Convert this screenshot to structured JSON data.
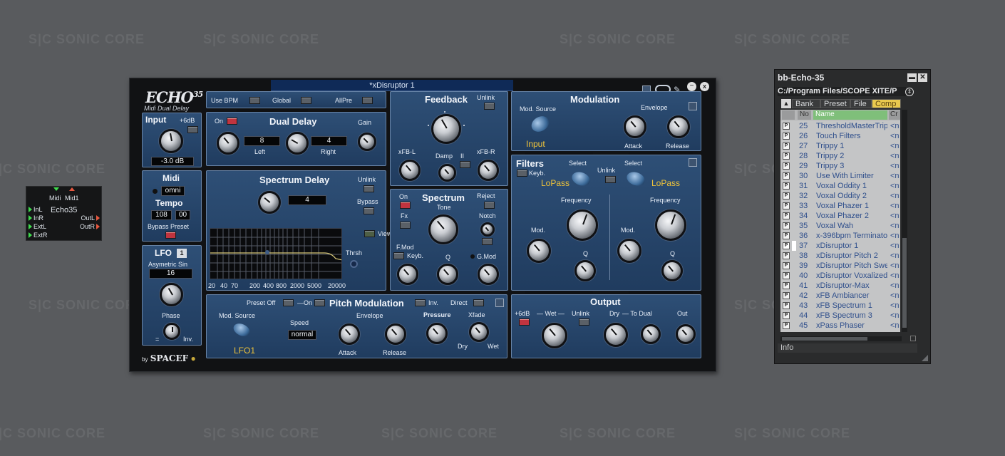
{
  "watermark": "S|C SONIC CORE",
  "module": {
    "top_ports": [
      "Midi",
      "Mid1"
    ],
    "name": "Echo35",
    "inputs": [
      "InL",
      "InR",
      "ExtL",
      "ExtR"
    ],
    "outputs": [
      "OutL",
      "OutR"
    ]
  },
  "plugin": {
    "title": "*xDisruptor 1",
    "logo_main": "ECHO",
    "logo_num": "35",
    "subtitle": "Midi Dual Delay",
    "by": "by",
    "brand": "SPACEF",
    "input": {
      "label": "Input",
      "plus6": "+6dB",
      "value": "-3.0 dB"
    },
    "midi": {
      "label": "Midi",
      "channel": "omni",
      "tempo_label": "Tempo",
      "tempo_int": "108",
      "tempo_frac": "00",
      "bypass_preset": "Bypass Preset"
    },
    "lfo": {
      "label": "LFO",
      "num": "1",
      "shape": "Asymetric Sin",
      "value": "16",
      "phase": "Phase",
      "eq": "=",
      "inv": "Inv."
    },
    "sync_bar": {
      "use_bpm": "Use BPM",
      "global": "Global",
      "allpre": "AllPre"
    },
    "dual_delay": {
      "label": "Dual Delay",
      "on": "On",
      "gain": "Gain",
      "left_value": "8",
      "right_value": "4",
      "left": "Left",
      "right": "Right"
    },
    "spectrum_delay": {
      "label": "Spectrum Delay",
      "value": "4",
      "unlink": "Unlink",
      "bypass": "Bypass",
      "view": "View",
      "thrsh": "Thrsh",
      "freq_ticks": [
        "20",
        "40",
        "70",
        "200",
        "400",
        "800",
        "2000",
        "5000",
        "20000"
      ]
    },
    "feedback": {
      "label": "Feedback",
      "unlink": "Unlink",
      "xfb_l": "xFB-L",
      "xfb_r": "xFB-R",
      "damp": "Damp",
      "damp_mark": "II"
    },
    "spectrum": {
      "label": "Spectrum",
      "on": "On",
      "fx": "Fx",
      "tone": "Tone",
      "reject": "Reject",
      "notch": "Notch",
      "fmod": "F.Mod",
      "keyb": "Keyb.",
      "q": "Q",
      "gmod": "G.Mod"
    },
    "modulation": {
      "label": "Modulation",
      "mod_source": "Mod. Source",
      "source_value": "Input",
      "envelope": "Envelope",
      "attack": "Attack",
      "release": "Release"
    },
    "filters": {
      "label": "Filters",
      "keyb": "Keyb.",
      "select": "Select",
      "unlink": "Unlink",
      "type1": "LoPass",
      "type2": "LoPass",
      "frequency": "Frequency",
      "mod": "Mod.",
      "q": "Q"
    },
    "pitch_mod": {
      "label": "Pitch Modulation",
      "preset_off": "Preset Off",
      "on": "On",
      "inv": "Inv.",
      "direct": "Direct",
      "mod_source": "Mod. Source",
      "source_value": "LFO1",
      "speed": "Speed",
      "speed_value": "normal",
      "envelope": "Envelope",
      "attack": "Attack",
      "release": "Release",
      "pressure": "Pressure",
      "xfade": "Xfade",
      "dry": "Dry",
      "wet": "Wet"
    },
    "output": {
      "label": "Output",
      "plus6": "+6dB",
      "wet": "Wet",
      "unlink": "Unlink",
      "dry": "Dry",
      "to_dual": "To Dual",
      "out": "Out"
    }
  },
  "browser": {
    "title": "bb-Echo-35",
    "path": "C:/Program Files/SCOPE XITE/P",
    "tabs": [
      "Bank",
      "Preset",
      "File",
      "Comp"
    ],
    "columns": [
      "No",
      "Name",
      "Cr"
    ],
    "rows": [
      {
        "no": "25",
        "name": "ThresholdMasterTripp",
        "cr": "<n"
      },
      {
        "no": "26",
        "name": "Touch Filters",
        "cr": "<n"
      },
      {
        "no": "27",
        "name": "Trippy 1",
        "cr": "<n"
      },
      {
        "no": "28",
        "name": "Trippy 2",
        "cr": "<n"
      },
      {
        "no": "29",
        "name": "Trippy 3",
        "cr": "<n"
      },
      {
        "no": "30",
        "name": "Use With Limiter",
        "cr": "<n"
      },
      {
        "no": "31",
        "name": "Voxal Oddity 1",
        "cr": "<n"
      },
      {
        "no": "32",
        "name": "Voxal Oddity 2",
        "cr": "<n"
      },
      {
        "no": "33",
        "name": "Voxal Phazer 1",
        "cr": "<n"
      },
      {
        "no": "34",
        "name": "Voxal Phazer 2",
        "cr": "<n"
      },
      {
        "no": "35",
        "name": "Voxal Wah",
        "cr": "<n"
      },
      {
        "no": "36",
        "name": "x-396bpm Terminator",
        "cr": "<n"
      },
      {
        "no": "37",
        "name": "xDisruptor 1",
        "cr": "<n"
      },
      {
        "no": "38",
        "name": "xDisruptor Pitch 2",
        "cr": "<n"
      },
      {
        "no": "39",
        "name": "xDisruptor Pitch Swe",
        "cr": "<n"
      },
      {
        "no": "40",
        "name": "xDisruptor Voxalized",
        "cr": "<n"
      },
      {
        "no": "41",
        "name": "xDisruptor-Max",
        "cr": "<n"
      },
      {
        "no": "42",
        "name": "xFB Ambiancer",
        "cr": "<n"
      },
      {
        "no": "43",
        "name": "xFB Spectrum 1",
        "cr": "<n"
      },
      {
        "no": "44",
        "name": "xFB Spectrum 3",
        "cr": "<n"
      },
      {
        "no": "45",
        "name": "xPass Phaser",
        "cr": "<n"
      }
    ],
    "selected_index": 12,
    "preset_btn": "P",
    "info": "Info"
  }
}
